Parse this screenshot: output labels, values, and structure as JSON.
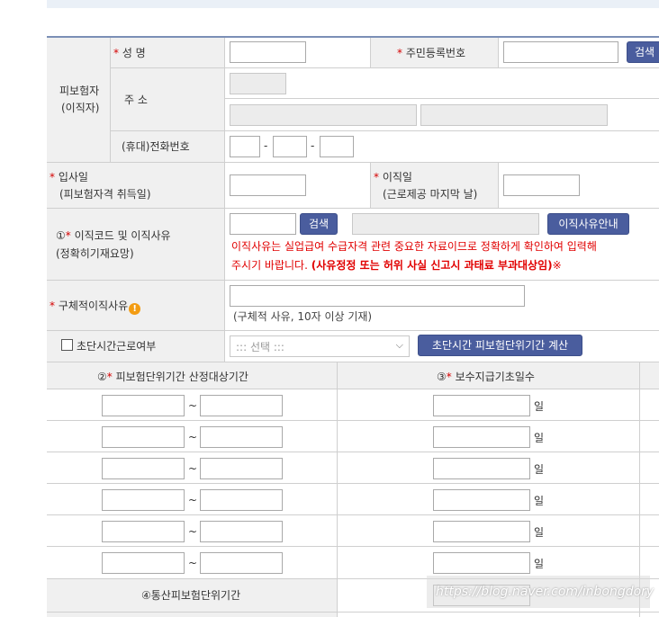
{
  "insured": {
    "group_label_line1": "피보험자",
    "group_label_line2": "(이직자)",
    "name_label": "성 명",
    "rrn_label": "주민등록번호",
    "rrn_search": "검색",
    "address_label": "주 소",
    "phone_label": "(휴대)전화번호",
    "phone_sep": "-"
  },
  "hire": {
    "label_line1": "입사일",
    "label_line2": "(피보험자격 취득일)",
    "leave_label_line1": "이직일",
    "leave_label_line2": "(근로제공 마지막 날)"
  },
  "reason": {
    "label_prefix": "①",
    "label_line1": "이직코드 및 이직사유",
    "label_line2": "(정확히기재요망)",
    "search_button": "검색",
    "guide_button": "이직사유안내",
    "warning_line1": "이직사유는 실업급여 수급자격 관련 중요한 자료이므로 정확하게 확인하여 입력해",
    "warning_line2_a": "주시기 바랍니다.",
    "warning_line2_b": "(사유정정 또는 허위 사실 신고시 과태료 부과대상임)",
    "warning_line2_c": "※"
  },
  "detail": {
    "label": "구체적이직사유",
    "hint": "(구체적 사유, 10자 이상 기재)"
  },
  "shortwork": {
    "label": "초단시간근로여부",
    "select_value": "::: 선택 :::",
    "calc_button": "초단시간 피보험단위기간 계산"
  },
  "periods": {
    "col1_header_prefix": "②",
    "col1_header": "피보험단위기간 산정대상기간",
    "col2_header_prefix": "③",
    "col2_header": "보수지급기초일수",
    "tilde": "~",
    "day_unit": "일",
    "row_count_label": "",
    "total_label": "④통산피보험단위기간"
  },
  "watermark": "https://blog.naver.com/inbongdory"
}
